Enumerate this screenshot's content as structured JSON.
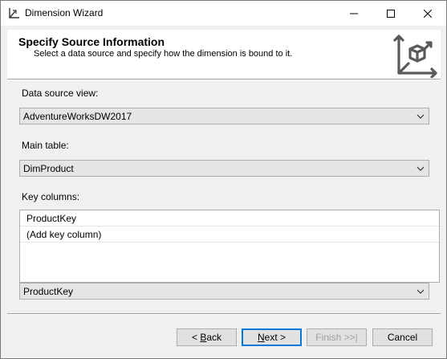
{
  "window": {
    "title": "Dimension Wizard",
    "icon": "dimension-wizard-icon",
    "controls": [
      "minimize-icon",
      "maximize-icon",
      "close-icon"
    ]
  },
  "header": {
    "title": "Specify Source Information",
    "subtitle": "Select a data source and specify how the dimension is bound to it.",
    "icon": "cube-axes-icon"
  },
  "data_source_view": {
    "label": "Data source view:",
    "value": "AdventureWorksDW2017"
  },
  "main_table": {
    "label": "Main table:",
    "value": "DimProduct"
  },
  "key_columns": {
    "label": "Key columns:",
    "rows": [
      "ProductKey",
      "(Add key column)"
    ],
    "selected_value": "ProductKey"
  },
  "buttons": {
    "back": {
      "pre": "< ",
      "accel": "B",
      "post": "ack"
    },
    "next": {
      "accel": "N",
      "post": "ext >"
    },
    "finish": "Finish >>|",
    "cancel": "Cancel"
  },
  "colors": {
    "accent": "#0078d7",
    "dialog_bg": "#f0f0f0",
    "combo_bg": "#e5e5e5"
  }
}
